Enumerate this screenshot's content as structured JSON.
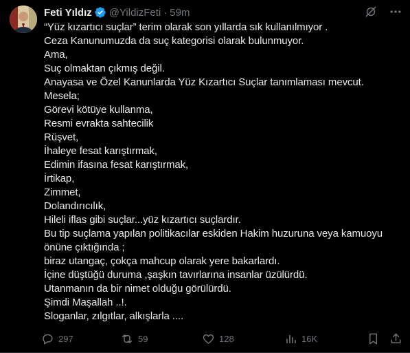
{
  "author": {
    "name": "Feti Yıldız",
    "handle": "@YildizFeti",
    "separator": "·",
    "time": "59m",
    "verified_color": "#1d9bf0"
  },
  "icons": {
    "top": [
      "grok-icon",
      "more-icon"
    ],
    "actions": [
      "reply-icon",
      "retweet-icon",
      "like-icon",
      "views-icon",
      "bookmark-icon",
      "share-icon"
    ]
  },
  "tweet_lines": [
    "“Yüz kızartıcı suçlar” terim olarak son yıllarda sık kullanılmıyor .",
    "Ceza Kanunumuzda da suç kategorisi olarak bulunmuyor.",
    "Ama,",
    "Suç olmaktan çıkmış değil.",
    "Anayasa  ve Özel Kanunlarda Yüz Kızartıcı Suçlar tanımlaması mevcut.",
    "Mesela;",
    "Görevi kötüye kullanma,",
    "Resmi evrakta sahtecilik",
    "Rüşvet,",
    "İhaleye fesat karıştırmak,",
    "Edimin ifasına fesat karıştırmak,",
    "İrtikap,",
    "Zimmet,",
    "Dolandırıcılık,",
    "Hileli iflas gibi suçlar...yüz kızartıcı suçlardır.",
    "Bu tip suçlama yapılan politikacılar eskiden Hakim huzuruna veya kamuoyu",
    "önüne çıktığında ;",
    "biraz utangaç, çokça mahcup olarak yere bakarlardı.",
    "İçine düştüğü duruma ,şaşkın tavırlarına insanlar üzülürdü.",
    "Utanmanın da bir nimet olduğu görülürdü.",
    "Şimdi Maşallah ..!.",
    "Sloganlar, zılgıtlar, alkışlarla ...."
  ],
  "stats": {
    "replies": "297",
    "retweets": "59",
    "likes": "128",
    "views": "16K"
  },
  "colors": {
    "background": "#000000",
    "text": "#e7e9ea",
    "muted": "#71767b"
  }
}
